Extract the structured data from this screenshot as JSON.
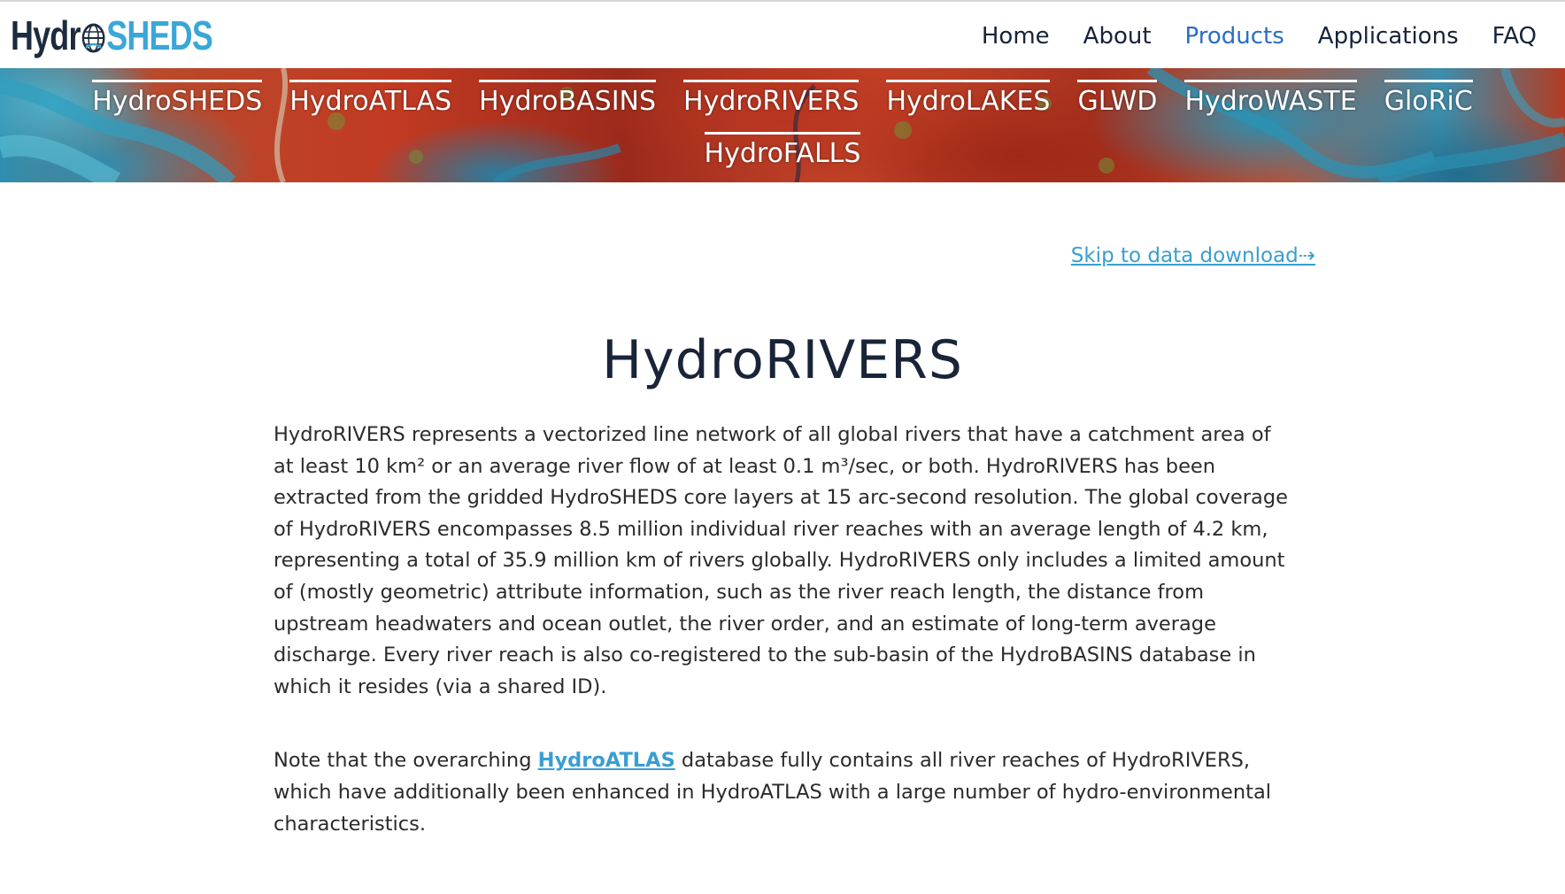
{
  "logo": {
    "part1": "Hydr",
    "part2": "SHEDS",
    "icon": "globe-icon"
  },
  "main_nav": [
    {
      "label": "Home",
      "active": false
    },
    {
      "label": "About",
      "active": false
    },
    {
      "label": "Products",
      "active": true
    },
    {
      "label": "Applications",
      "active": false
    },
    {
      "label": "FAQ",
      "active": false
    }
  ],
  "sub_nav": {
    "row1": [
      "HydroSHEDS",
      "HydroATLAS",
      "HydroBASINS",
      "HydroRIVERS",
      "HydroLAKES",
      "GLWD",
      "HydroWASTE",
      "GloRiC"
    ],
    "row2": [
      "HydroFALLS"
    ]
  },
  "skip_link": "Skip to data download⇢",
  "page": {
    "title": "HydroRIVERS",
    "paragraph1": "HydroRIVERS represents a vectorized line network of all global rivers that have a catchment area of at least 10 km² or an average river flow of at least 0.1 m³/sec, or both. HydroRIVERS has been extracted from the gridded HydroSHEDS core layers at 15 arc-second resolution. The global coverage of HydroRIVERS encompasses 8.5 million individual river reaches with an average length of 4.2 km, representing a total of 35.9 million km of rivers globally. HydroRIVERS only includes a limited amount of (mostly geometric) attribute information, such as the river reach length, the distance from upstream headwaters and ocean outlet, the river order, and an estimate of long-term average discharge. Every river reach is also co-registered to the sub-basin of the HydroBASINS database in which it resides (via a shared ID).",
    "paragraph2_before": "Note that the overarching ",
    "paragraph2_link": "HydroATLAS",
    "paragraph2_after": " database fully contains all river reaches of HydroRIVERS, which have additionally been enhanced in HydroATLAS with a large number of hydro-environmental characteristics."
  },
  "colors": {
    "accent": "#3a9ed1",
    "active_nav": "#2a6dc4",
    "heading": "#1a2438",
    "logo_dark": "#1d2b3e",
    "logo_light": "#3aa7d6"
  }
}
